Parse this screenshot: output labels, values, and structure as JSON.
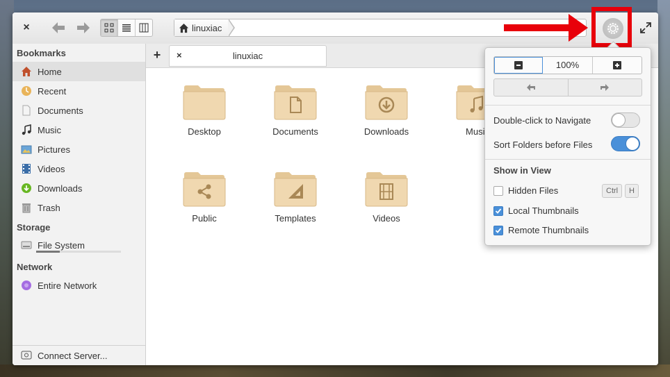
{
  "window": {
    "path": [
      "linuxiac"
    ],
    "tab_add": "+",
    "tab_close": "×",
    "close_glyph": "×",
    "tab_title": "linuxiac"
  },
  "sidebar": {
    "bookmarks_heading": "Bookmarks",
    "bookmarks": [
      {
        "label": "Home",
        "icon": "home-icon",
        "active": true
      },
      {
        "label": "Recent",
        "icon": "recent-icon"
      },
      {
        "label": "Documents",
        "icon": "documents-icon"
      },
      {
        "label": "Music",
        "icon": "music-icon"
      },
      {
        "label": "Pictures",
        "icon": "pictures-icon"
      },
      {
        "label": "Videos",
        "icon": "videos-icon"
      },
      {
        "label": "Downloads",
        "icon": "downloads-icon"
      },
      {
        "label": "Trash",
        "icon": "trash-icon"
      }
    ],
    "storage_heading": "Storage",
    "storage": [
      {
        "label": "File System",
        "icon": "drive-icon",
        "usage": 0.28
      }
    ],
    "network_heading": "Network",
    "network": [
      {
        "label": "Entire Network",
        "icon": "network-icon"
      }
    ],
    "footer": {
      "label": "Connect Server...",
      "icon": "server-icon"
    }
  },
  "folders": [
    {
      "label": "Desktop",
      "emblem": "none"
    },
    {
      "label": "Documents",
      "emblem": "document"
    },
    {
      "label": "Downloads",
      "emblem": "download"
    },
    {
      "label": "Music",
      "emblem": "music"
    },
    {
      "label": "Public",
      "emblem": "share"
    },
    {
      "label": "Templates",
      "emblem": "template"
    },
    {
      "label": "Videos",
      "emblem": "video"
    }
  ],
  "popover": {
    "zoom_value": "100%",
    "double_click_label": "Double-click to Navigate",
    "double_click_enabled": false,
    "sort_folders_label": "Sort Folders before Files",
    "sort_folders_enabled": true,
    "show_in_view_heading": "Show in View",
    "hidden_files_label": "Hidden Files",
    "hidden_files_checked": false,
    "shortcut_key1": "Ctrl",
    "shortcut_key2": "H",
    "local_thumbnails_label": "Local Thumbnails",
    "local_thumbnails_checked": true,
    "remote_thumbnails_label": "Remote Thumbnails",
    "remote_thumbnails_checked": true
  },
  "colors": {
    "accent": "#4a90d9",
    "annotation_red": "#e8000a",
    "folder_fill": "#f0d8b0"
  }
}
